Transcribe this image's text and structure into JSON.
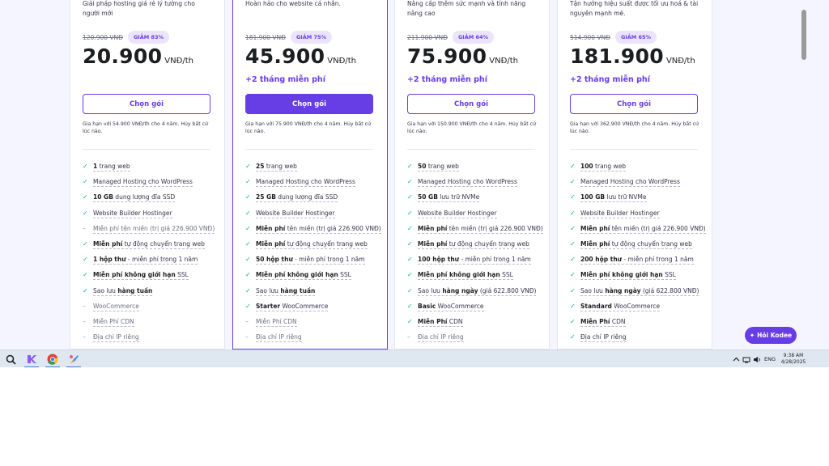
{
  "plans": [
    {
      "description": "Giải pháp hosting giá rẻ lý tưởng cho người mới",
      "old_price": "120.900 VNĐ",
      "discount": "GIẢM 83%",
      "price": "20.900",
      "unit": "VNĐ/th",
      "free_months": "",
      "button": "Chọn gói",
      "renew": "Gia hạn với 54.900 VNĐ/th cho 4 năm. Hủy bất cứ lúc nào.",
      "features": [
        {
          "on": true,
          "bold": "1",
          "text": " trang web"
        },
        {
          "on": true,
          "bold": "",
          "text": "Managed Hosting cho WordPress"
        },
        {
          "on": true,
          "bold": "10 GB",
          "text": " dung lượng đĩa SSD"
        },
        {
          "on": true,
          "bold": "",
          "text": "Website Builder Hostinger"
        },
        {
          "on": false,
          "bold": "",
          "text": "Miễn phí tên miền (trị giá 226.900 VNĐ)"
        },
        {
          "on": true,
          "bold": "Miễn phí",
          "text": " tự động chuyển trang web"
        },
        {
          "on": true,
          "bold": "1 hộp thư",
          "text": " - miễn phí trong 1 năm"
        },
        {
          "on": true,
          "bold": "Miễn phí không giới hạn",
          "text": " SSL"
        },
        {
          "on": true,
          "bold": "",
          "text": "Sao lưu ",
          "bold2": "hàng tuần"
        },
        {
          "on": false,
          "bold": "",
          "text": "WooCommerce"
        },
        {
          "on": false,
          "bold": "",
          "text": "Miễn Phí CDN"
        },
        {
          "on": false,
          "bold": "",
          "text": "Địa chỉ IP riêng"
        }
      ]
    },
    {
      "description": "Hoàn hảo cho website cá nhân.",
      "old_price": "181.900 VNĐ",
      "discount": "GIẢM 75%",
      "price": "45.900",
      "unit": "VNĐ/th",
      "free_months": "+2 tháng miễn phí",
      "button": "Chọn gói",
      "renew": "Gia hạn với 75.900 VNĐ/th cho 4 năm. Hủy bất cứ lúc nào.",
      "features": [
        {
          "on": true,
          "bold": "25",
          "text": " trang web"
        },
        {
          "on": true,
          "bold": "",
          "text": "Managed Hosting cho WordPress"
        },
        {
          "on": true,
          "bold": "25 GB",
          "text": " dung lượng đĩa SSD"
        },
        {
          "on": true,
          "bold": "",
          "text": "Website Builder Hostinger"
        },
        {
          "on": true,
          "bold": "Miễn phí",
          "text": " tên miền (trị giá 226.900 VNĐ)"
        },
        {
          "on": true,
          "bold": "Miễn phí",
          "text": " tự động chuyển trang web"
        },
        {
          "on": true,
          "bold": "50 hộp thư",
          "text": " - miễn phí trong 1 năm"
        },
        {
          "on": true,
          "bold": "Miễn phí không giới hạn",
          "text": " SSL"
        },
        {
          "on": true,
          "bold": "",
          "text": "Sao lưu ",
          "bold2": "hàng tuần"
        },
        {
          "on": true,
          "bold": "Starter",
          "text": " WooCommerce"
        },
        {
          "on": false,
          "bold": "",
          "text": "Miễn Phí CDN"
        },
        {
          "on": false,
          "bold": "",
          "text": "Địa chỉ IP riêng"
        }
      ]
    },
    {
      "description": "Nâng cấp thêm sức mạnh và tính năng nâng cao",
      "old_price": "211.900 VNĐ",
      "discount": "GIẢM 64%",
      "price": "75.900",
      "unit": "VNĐ/th",
      "free_months": "+2 tháng miễn phí",
      "button": "Chọn gói",
      "renew": "Gia hạn với 150.900 VNĐ/th cho 4 năm. Hủy bất cứ lúc nào.",
      "features": [
        {
          "on": true,
          "bold": "50",
          "text": " trang web"
        },
        {
          "on": true,
          "bold": "",
          "text": "Managed Hosting cho WordPress"
        },
        {
          "on": true,
          "bold": "50 GB",
          "text": " lưu trữ NVMe"
        },
        {
          "on": true,
          "bold": "",
          "text": "Website Builder Hostinger"
        },
        {
          "on": true,
          "bold": "Miễn phí",
          "text": " tên miền (trị giá 226.900 VNĐ)"
        },
        {
          "on": true,
          "bold": "Miễn phí",
          "text": " tự động chuyển trang web"
        },
        {
          "on": true,
          "bold": "100 hộp thư",
          "text": " - miễn phí trong 1 năm"
        },
        {
          "on": true,
          "bold": "Miễn phí không giới hạn",
          "text": " SSL"
        },
        {
          "on": true,
          "bold": "",
          "text": "Sao lưu ",
          "bold2": "hàng ngày",
          "text2": " (giá 622.800 VNĐ)"
        },
        {
          "on": true,
          "bold": "Basic",
          "text": " WooCommerce"
        },
        {
          "on": true,
          "bold": "Miễn Phí",
          "text": " CDN"
        },
        {
          "on": false,
          "bold": "",
          "text": "Địa chỉ IP riêng"
        }
      ]
    },
    {
      "description": "Tận hưởng hiệu suất được tối ưu hoá & tài nguyên mạnh mẽ.",
      "old_price": "514.900 VNĐ",
      "discount": "GIẢM 65%",
      "price": "181.900",
      "unit": "VNĐ/th",
      "free_months": "+2 tháng miễn phí",
      "button": "Chọn gói",
      "renew": "Gia hạn với 362.900 VNĐ/th cho 4 năm. Hủy bất cứ lúc nào.",
      "features": [
        {
          "on": true,
          "bold": "100",
          "text": " trang web"
        },
        {
          "on": true,
          "bold": "",
          "text": "Managed Hosting cho WordPress"
        },
        {
          "on": true,
          "bold": "100 GB",
          "text": " lưu trữ NVMe"
        },
        {
          "on": true,
          "bold": "",
          "text": "Website Builder Hostinger"
        },
        {
          "on": true,
          "bold": "Miễn phí",
          "text": " tên miền (trị giá 226.900 VNĐ)"
        },
        {
          "on": true,
          "bold": "Miễn phí",
          "text": " tự động chuyển trang web"
        },
        {
          "on": true,
          "bold": "200 hộp thư",
          "text": " - miễn phí trong 1 năm"
        },
        {
          "on": true,
          "bold": "Miễn phí không giới hạn",
          "text": " SSL"
        },
        {
          "on": true,
          "bold": "",
          "text": "Sao lưu ",
          "bold2": "hàng ngày",
          "text2": " (giá 622.800 VNĐ)"
        },
        {
          "on": true,
          "bold": "Standard",
          "text": " WooCommerce"
        },
        {
          "on": true,
          "bold": "Miễn Phí",
          "text": " CDN"
        },
        {
          "on": true,
          "bold": "",
          "text": "Địa chỉ IP riêng"
        }
      ]
    }
  ],
  "chat_button": "Hỏi Kodee",
  "taskbar": {
    "apps": [
      "search-icon",
      "kodee-app-icon",
      "chrome-icon",
      "paint-icon"
    ],
    "language": "ENG",
    "time": "9:38 AM",
    "date": "4/28/2025"
  },
  "colors": {
    "accent": "#673de6",
    "check": "#00b090",
    "page_bg": "#f4f5ff",
    "taskbar_bg": "#dfe8f1"
  }
}
